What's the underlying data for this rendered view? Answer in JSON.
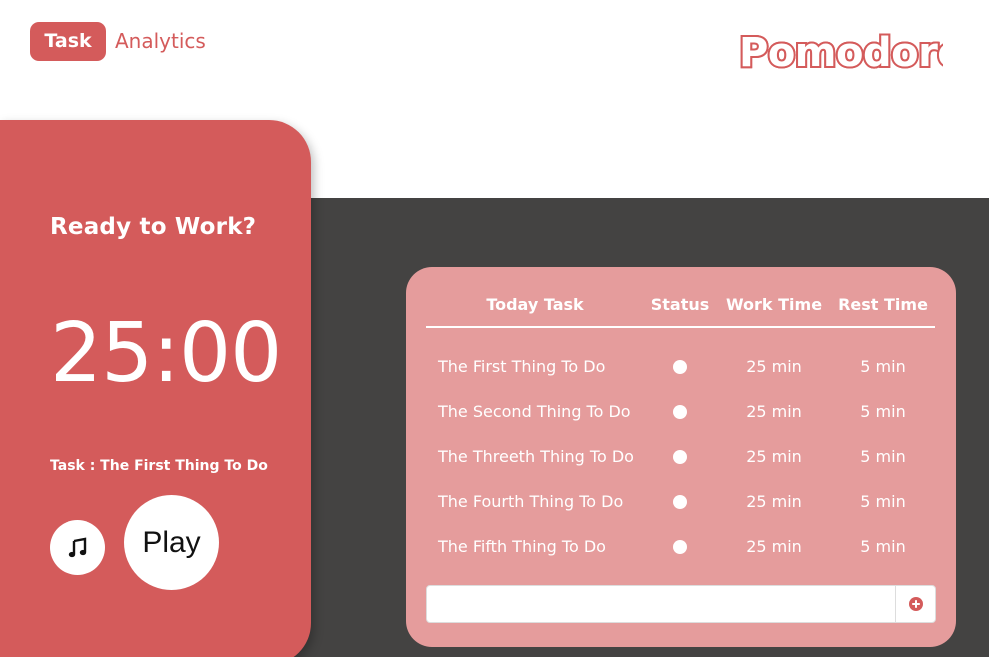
{
  "nav": {
    "tabs": [
      {
        "label": "Task",
        "active": true
      },
      {
        "label": "Analytics",
        "active": false
      }
    ]
  },
  "brand": {
    "logo_text": "Pomodoro"
  },
  "timer_panel": {
    "title": "Ready to Work?",
    "time": "25:00",
    "current_task": "Task : The First Thing To Do",
    "music_icon": "music-note-icon",
    "play_label": "Play"
  },
  "task_table": {
    "headers": [
      "Today Task",
      "Status",
      "Work Time",
      "Rest Time"
    ],
    "rows": [
      {
        "name": "The First Thing To Do",
        "status": "incomplete",
        "work": "25 min",
        "rest": "5 min"
      },
      {
        "name": "The Second Thing To Do",
        "status": "incomplete",
        "work": "25 min",
        "rest": "5 min"
      },
      {
        "name": "The Threeth Thing To Do",
        "status": "incomplete",
        "work": "25 min",
        "rest": "5 min"
      },
      {
        "name": "The Fourth Thing To Do",
        "status": "incomplete",
        "work": "25 min",
        "rest": "5 min"
      },
      {
        "name": "The Fifth Thing To Do",
        "status": "incomplete",
        "work": "25 min",
        "rest": "5 min"
      }
    ],
    "new_task_value": "",
    "add_icon": "plus-circle-icon"
  },
  "colors": {
    "primary": "#d45b5b",
    "card": "#e59c9c",
    "dark_bg": "#444342"
  }
}
